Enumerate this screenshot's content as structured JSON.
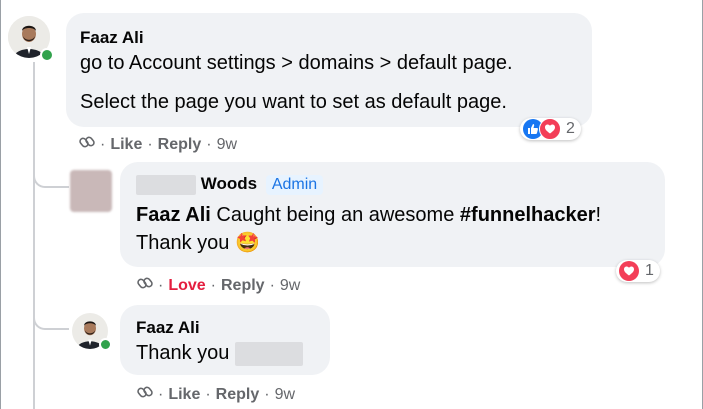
{
  "comment_main": {
    "author": "Faaz Ali",
    "line1": "go to Account settings > domains > default page.",
    "line2": "Select the page you want to set as default page.",
    "actions": {
      "like": "Like",
      "reply": "Reply",
      "time": "9w"
    },
    "reaction_count": "2"
  },
  "reply_admin": {
    "author_visible": "Woods",
    "badge": "Admin",
    "mention": "Faaz Ali",
    "text_mid": " Caught being an awesome ",
    "hashtag": "#funnelhacker",
    "text_end": "!",
    "line2": "Thank you",
    "emoji": "🤩",
    "actions": {
      "love": "Love",
      "reply": "Reply",
      "time": "9w"
    },
    "reaction_count": "1"
  },
  "reply_faaz": {
    "author": "Faaz Ali",
    "text": "Thank you",
    "actions": {
      "like": "Like",
      "reply": "Reply",
      "time": "9w"
    }
  },
  "colors": {
    "like_blue": "#1877f2",
    "love_red": "#e41e3f",
    "bubble": "#f0f2f5",
    "online": "#31a24c"
  }
}
